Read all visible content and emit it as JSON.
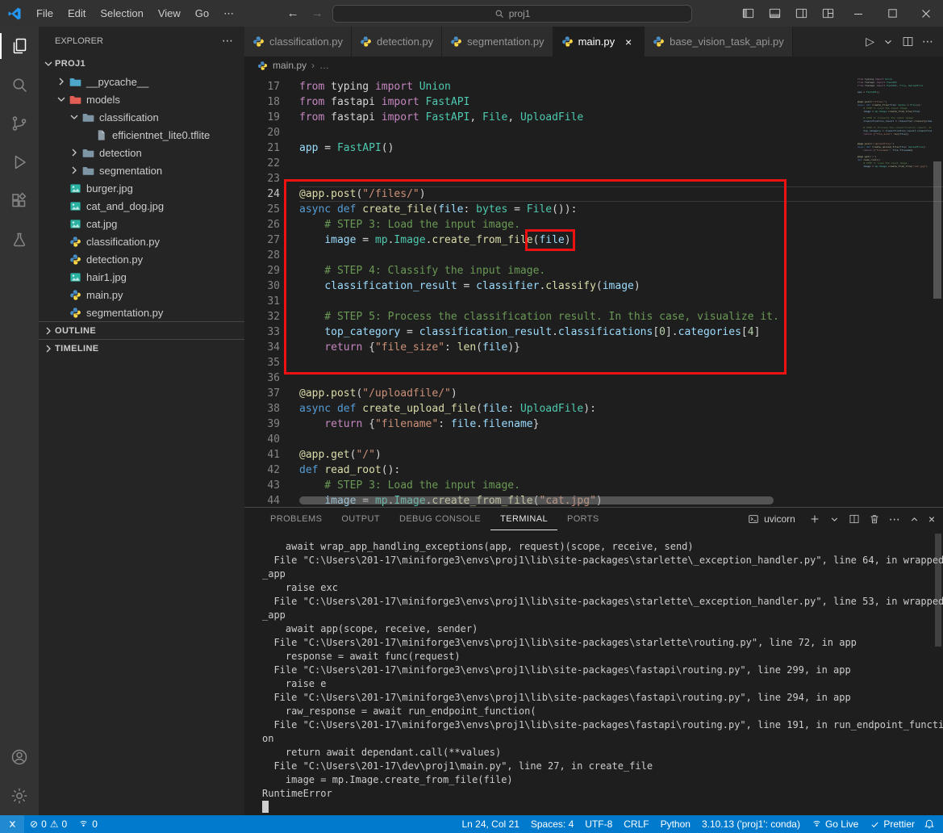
{
  "colors": {
    "annotation": "#ee1111",
    "status_bar": "#007acc",
    "title_bar": "#323233",
    "activity_bar": "#333333",
    "side_bar": "#252526",
    "editor_bg": "#1e1e1e"
  },
  "icons": {
    "more": "⋯",
    "close": "×",
    "back": "←",
    "forward": "→",
    "chevron_right": "›",
    "error": "⊘",
    "warning": "⚠",
    "play": "▷"
  },
  "titlebar": {
    "menus": [
      "File",
      "Edit",
      "Selection",
      "View",
      "Go"
    ],
    "search_text": "proj1"
  },
  "activitybar": {
    "items": [
      "explorer",
      "search",
      "source-control",
      "run-and-debug",
      "extensions",
      "testing"
    ],
    "bottom": [
      "account",
      "settings"
    ],
    "active": "explorer"
  },
  "explorer": {
    "header": "EXPLORER",
    "root": "PROJ1",
    "sections": [
      "OUTLINE",
      "TIMELINE"
    ],
    "tree": [
      {
        "label": "__pycache__",
        "icon": "folder",
        "color": "#4da6c9",
        "depth": 1,
        "open": false
      },
      {
        "label": "models",
        "icon": "folder",
        "color": "#e25d54",
        "depth": 1,
        "open": true
      },
      {
        "label": "classification",
        "icon": "folder",
        "color": "#7e95a5",
        "depth": 2,
        "open": true
      },
      {
        "label": "efficientnet_lite0.tflite",
        "icon": "file",
        "depth": 3
      },
      {
        "label": "detection",
        "icon": "folder",
        "color": "#7e95a5",
        "depth": 2,
        "open": false
      },
      {
        "label": "segmentation",
        "icon": "folder",
        "color": "#7e95a5",
        "depth": 2,
        "open": false
      },
      {
        "label": "burger.jpg",
        "icon": "image",
        "depth": 1
      },
      {
        "label": "cat_and_dog.jpg",
        "icon": "image",
        "depth": 1
      },
      {
        "label": "cat.jpg",
        "icon": "image",
        "depth": 1
      },
      {
        "label": "classification.py",
        "icon": "python",
        "depth": 1
      },
      {
        "label": "detection.py",
        "icon": "python",
        "depth": 1
      },
      {
        "label": "hair1.jpg",
        "icon": "image",
        "depth": 1
      },
      {
        "label": "main.py",
        "icon": "python",
        "depth": 1
      },
      {
        "label": "segmentation.py",
        "icon": "python",
        "depth": 1
      }
    ]
  },
  "tabs": [
    {
      "label": "classification.py",
      "active": false
    },
    {
      "label": "detection.py",
      "active": false
    },
    {
      "label": "segmentation.py",
      "active": false
    },
    {
      "label": "main.py",
      "active": true
    },
    {
      "label": "base_vision_task_api.py",
      "active": false
    }
  ],
  "breadcrumb": {
    "file": "main.py",
    "more": "…"
  },
  "editor": {
    "current_line": 24,
    "lines": [
      {
        "n": 17,
        "t": [
          [
            "from",
            "k"
          ],
          [
            " typing ",
            "p"
          ],
          [
            "import",
            "k"
          ],
          [
            " Union",
            "t"
          ]
        ]
      },
      {
        "n": 18,
        "t": [
          [
            "from",
            "k"
          ],
          [
            " fastapi ",
            "p"
          ],
          [
            "import",
            "k"
          ],
          [
            " FastAPI",
            "t"
          ]
        ]
      },
      {
        "n": 19,
        "t": [
          [
            "from",
            "k"
          ],
          [
            " fastapi ",
            "p"
          ],
          [
            "import",
            "k"
          ],
          [
            " FastAPI",
            "t"
          ],
          [
            ", ",
            "p"
          ],
          [
            "File",
            "t"
          ],
          [
            ", ",
            "p"
          ],
          [
            "UploadFile",
            "t"
          ]
        ]
      },
      {
        "n": 20,
        "t": []
      },
      {
        "n": 21,
        "t": [
          [
            "app",
            "v"
          ],
          [
            " = ",
            "p"
          ],
          [
            "FastAPI",
            "t"
          ],
          [
            "()",
            "p"
          ]
        ]
      },
      {
        "n": 22,
        "t": []
      },
      {
        "n": 23,
        "t": []
      },
      {
        "n": 24,
        "t": [
          [
            "@app.post",
            "f"
          ],
          [
            "(",
            "p"
          ],
          [
            "\"/files/\"",
            "s"
          ],
          [
            ")",
            "p"
          ]
        ]
      },
      {
        "n": 25,
        "t": [
          [
            "async",
            "b"
          ],
          [
            " ",
            "p"
          ],
          [
            "def",
            "b"
          ],
          [
            " ",
            "p"
          ],
          [
            "create_file",
            "f"
          ],
          [
            "(",
            "p"
          ],
          [
            "file",
            "v"
          ],
          [
            ": ",
            "p"
          ],
          [
            "bytes",
            "t"
          ],
          [
            " = ",
            "p"
          ],
          [
            "File",
            "t"
          ],
          [
            "()):",
            "p"
          ]
        ]
      },
      {
        "n": 26,
        "t": [
          [
            "    # STEP 3: Load the input image.",
            "c"
          ]
        ]
      },
      {
        "n": 27,
        "t": [
          [
            "    ",
            "p"
          ],
          [
            "image",
            "v"
          ],
          [
            " = ",
            "p"
          ],
          [
            "mp",
            "t"
          ],
          [
            ".",
            "p"
          ],
          [
            "Image",
            "t"
          ],
          [
            ".",
            "p"
          ],
          [
            "create_from_file",
            "f"
          ],
          [
            "(",
            "p"
          ],
          [
            "file",
            "v"
          ],
          [
            ")",
            "p"
          ]
        ]
      },
      {
        "n": 28,
        "t": []
      },
      {
        "n": 29,
        "t": [
          [
            "    # STEP 4: Classify the input image.",
            "c"
          ]
        ]
      },
      {
        "n": 30,
        "t": [
          [
            "    ",
            "p"
          ],
          [
            "classification_result",
            "v"
          ],
          [
            " = ",
            "p"
          ],
          [
            "classifier",
            "v"
          ],
          [
            ".",
            "p"
          ],
          [
            "classify",
            "f"
          ],
          [
            "(",
            "p"
          ],
          [
            "image",
            "v"
          ],
          [
            ")",
            "p"
          ]
        ]
      },
      {
        "n": 31,
        "t": []
      },
      {
        "n": 32,
        "t": [
          [
            "    # STEP 5: Process the classification result. In this case, visualize it.",
            "c"
          ]
        ]
      },
      {
        "n": 33,
        "t": [
          [
            "    ",
            "p"
          ],
          [
            "top_category",
            "v"
          ],
          [
            " = ",
            "p"
          ],
          [
            "classification_result",
            "v"
          ],
          [
            ".",
            "p"
          ],
          [
            "classifications",
            "v"
          ],
          [
            "[",
            "p"
          ],
          [
            "0",
            "n"
          ],
          [
            "].",
            "p"
          ],
          [
            "categories",
            "v"
          ],
          [
            "[",
            "p"
          ],
          [
            "4",
            "n"
          ],
          [
            "]",
            "p"
          ]
        ]
      },
      {
        "n": 34,
        "t": [
          [
            "    ",
            "p"
          ],
          [
            "return",
            "k"
          ],
          [
            " {",
            "p"
          ],
          [
            "\"file_size\"",
            "s"
          ],
          [
            ": ",
            "p"
          ],
          [
            "len",
            "f"
          ],
          [
            "(",
            "p"
          ],
          [
            "file",
            "v"
          ],
          [
            ")}",
            "p"
          ]
        ]
      },
      {
        "n": 35,
        "t": []
      },
      {
        "n": 36,
        "t": []
      },
      {
        "n": 37,
        "t": [
          [
            "@app.post",
            "f"
          ],
          [
            "(",
            "p"
          ],
          [
            "\"/uploadfile/\"",
            "s"
          ],
          [
            ")",
            "p"
          ]
        ]
      },
      {
        "n": 38,
        "t": [
          [
            "async",
            "b"
          ],
          [
            " ",
            "p"
          ],
          [
            "def",
            "b"
          ],
          [
            " ",
            "p"
          ],
          [
            "create_upload_file",
            "f"
          ],
          [
            "(",
            "p"
          ],
          [
            "file",
            "v"
          ],
          [
            ": ",
            "p"
          ],
          [
            "UploadFile",
            "t"
          ],
          [
            "):",
            "p"
          ]
        ]
      },
      {
        "n": 39,
        "t": [
          [
            "    ",
            "p"
          ],
          [
            "return",
            "k"
          ],
          [
            " {",
            "p"
          ],
          [
            "\"filename\"",
            "s"
          ],
          [
            ": ",
            "p"
          ],
          [
            "file",
            "v"
          ],
          [
            ".",
            "p"
          ],
          [
            "filename",
            "v"
          ],
          [
            "}",
            "p"
          ]
        ]
      },
      {
        "n": 40,
        "t": []
      },
      {
        "n": 41,
        "t": [
          [
            "@app.get",
            "f"
          ],
          [
            "(",
            "p"
          ],
          [
            "\"/\"",
            "s"
          ],
          [
            ")",
            "p"
          ]
        ]
      },
      {
        "n": 42,
        "t": [
          [
            "def",
            "b"
          ],
          [
            " ",
            "p"
          ],
          [
            "read_root",
            "f"
          ],
          [
            "():",
            "p"
          ]
        ]
      },
      {
        "n": 43,
        "t": [
          [
            "    # STEP 3: Load the input image.",
            "c"
          ]
        ]
      },
      {
        "n": 44,
        "t": [
          [
            "    ",
            "p"
          ],
          [
            "image",
            "v"
          ],
          [
            " = ",
            "p"
          ],
          [
            "mp",
            "t"
          ],
          [
            ".",
            "p"
          ],
          [
            "Image",
            "t"
          ],
          [
            ".",
            "p"
          ],
          [
            "create_from_file",
            "f"
          ],
          [
            "(",
            "p"
          ],
          [
            "\"cat.jpg\"",
            "s"
          ],
          [
            ")",
            "p"
          ]
        ]
      }
    ]
  },
  "panel": {
    "tabs": [
      {
        "label": "PROBLEMS",
        "active": false
      },
      {
        "label": "OUTPUT",
        "active": false
      },
      {
        "label": "DEBUG CONSOLE",
        "active": false
      },
      {
        "label": "TERMINAL",
        "active": true
      },
      {
        "label": "PORTS",
        "active": false
      }
    ],
    "terminal_title": "uvicorn",
    "lines": [
      "    await wrap_app_handling_exceptions(app, request)(scope, receive, send)",
      "  File \"C:\\Users\\201-17\\miniforge3\\envs\\proj1\\lib\\site-packages\\starlette\\_exception_handler.py\", line 64, in wrapped",
      "_app",
      "    raise exc",
      "  File \"C:\\Users\\201-17\\miniforge3\\envs\\proj1\\lib\\site-packages\\starlette\\_exception_handler.py\", line 53, in wrapped",
      "_app",
      "    await app(scope, receive, sender)",
      "  File \"C:\\Users\\201-17\\miniforge3\\envs\\proj1\\lib\\site-packages\\starlette\\routing.py\", line 72, in app",
      "    response = await func(request)",
      "  File \"C:\\Users\\201-17\\miniforge3\\envs\\proj1\\lib\\site-packages\\fastapi\\routing.py\", line 299, in app",
      "    raise e",
      "  File \"C:\\Users\\201-17\\miniforge3\\envs\\proj1\\lib\\site-packages\\fastapi\\routing.py\", line 294, in app",
      "    raw_response = await run_endpoint_function(",
      "  File \"C:\\Users\\201-17\\miniforge3\\envs\\proj1\\lib\\site-packages\\fastapi\\routing.py\", line 191, in run_endpoint_functi",
      "on",
      "    return await dependant.call(**values)",
      "  File \"C:\\Users\\201-17\\dev\\proj1\\main.py\", line 27, in create_file",
      "    image = mp.Image.create_from_file(file)",
      "RuntimeError"
    ]
  },
  "statusbar": {
    "errors": "0",
    "warnings": "0",
    "ports": "0",
    "right": [
      {
        "name": "cursor-position",
        "label": "Ln 24, Col 21"
      },
      {
        "name": "indentation",
        "label": "Spaces: 4"
      },
      {
        "name": "encoding",
        "label": "UTF-8"
      },
      {
        "name": "eol",
        "label": "CRLF"
      },
      {
        "name": "language-mode",
        "label": "Python"
      },
      {
        "name": "python-interpreter",
        "label": "3.10.13 ('proj1': conda)"
      },
      {
        "name": "go-live",
        "label": "Go Live",
        "icon": "broadcast"
      },
      {
        "name": "prettier",
        "label": "Prettier",
        "icon": "check"
      }
    ]
  }
}
